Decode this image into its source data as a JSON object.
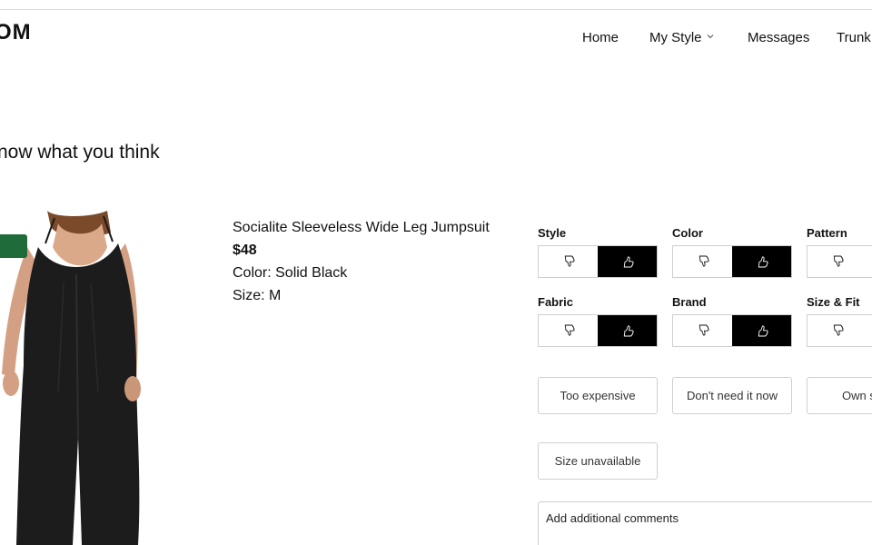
{
  "header": {
    "logo_text": "OM",
    "nav": {
      "home": "Home",
      "my_style": "My Style",
      "messages": "Messages",
      "trunk": "Trunk"
    }
  },
  "heading": "now what you think",
  "product": {
    "name": "Socialite Sleeveless Wide Leg Jumpsuit",
    "price": "$48",
    "color": "Color: Solid Black",
    "size": "Size: M"
  },
  "feedback": {
    "style": {
      "label": "Style",
      "rating": "thumbs-up"
    },
    "color": {
      "label": "Color",
      "rating": "thumbs-up"
    },
    "pattern": {
      "label": "Pattern",
      "rating": "none"
    },
    "fabric": {
      "label": "Fabric",
      "rating": "thumbs-up"
    },
    "brand": {
      "label": "Brand",
      "rating": "thumbs-up"
    },
    "size_fit": {
      "label": "Size & Fit",
      "rating": "none"
    }
  },
  "reasons": {
    "too_expensive": "Too expensive",
    "dont_need": "Don't need it now",
    "own_similar": "Own s",
    "size_unavailable": "Size unavailable"
  },
  "comments_placeholder": "Add additional comments",
  "colors": {
    "selected_bg": "#000000",
    "badge": "#1f6b3a",
    "border": "#cfcfcf"
  }
}
